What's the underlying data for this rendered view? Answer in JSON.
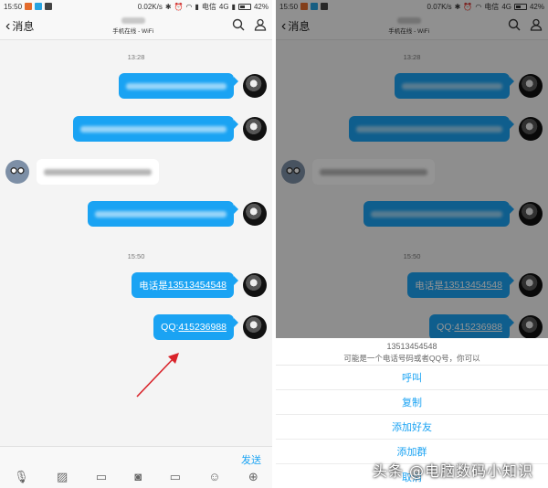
{
  "status_bar": {
    "time": "15:50",
    "speed_left": "0.02K/s",
    "speed_right": "0.07K/s",
    "carrier": "电信",
    "network": "4G",
    "battery": "42%"
  },
  "nav": {
    "back_label": "消息",
    "subtitle": "手机在线 - WiFi",
    "search_icon": "search-icon",
    "profile_icon": "person-icon"
  },
  "chat": {
    "timestamps": [
      "13:28",
      "15:50"
    ],
    "phone_prefix": "电话是",
    "phone_number": "13513454548",
    "qq_prefix": "QQ:",
    "qq_number": "415236988"
  },
  "composer": {
    "send_label": "发送",
    "icons": [
      "mic-icon",
      "image-icon",
      "video-icon",
      "camera-icon",
      "folder-icon",
      "emoji-icon",
      "plus-icon"
    ]
  },
  "sheet": {
    "number": "13513454548",
    "hint": "可能是一个电话号码或者QQ号，你可以",
    "options": [
      "呼叫",
      "复制",
      "添加好友",
      "添加群",
      "取消"
    ]
  },
  "watermark": "头条 @电脑数码小知识",
  "colors": {
    "accent": "#1aa3f3",
    "arrow": "#d9232a"
  }
}
